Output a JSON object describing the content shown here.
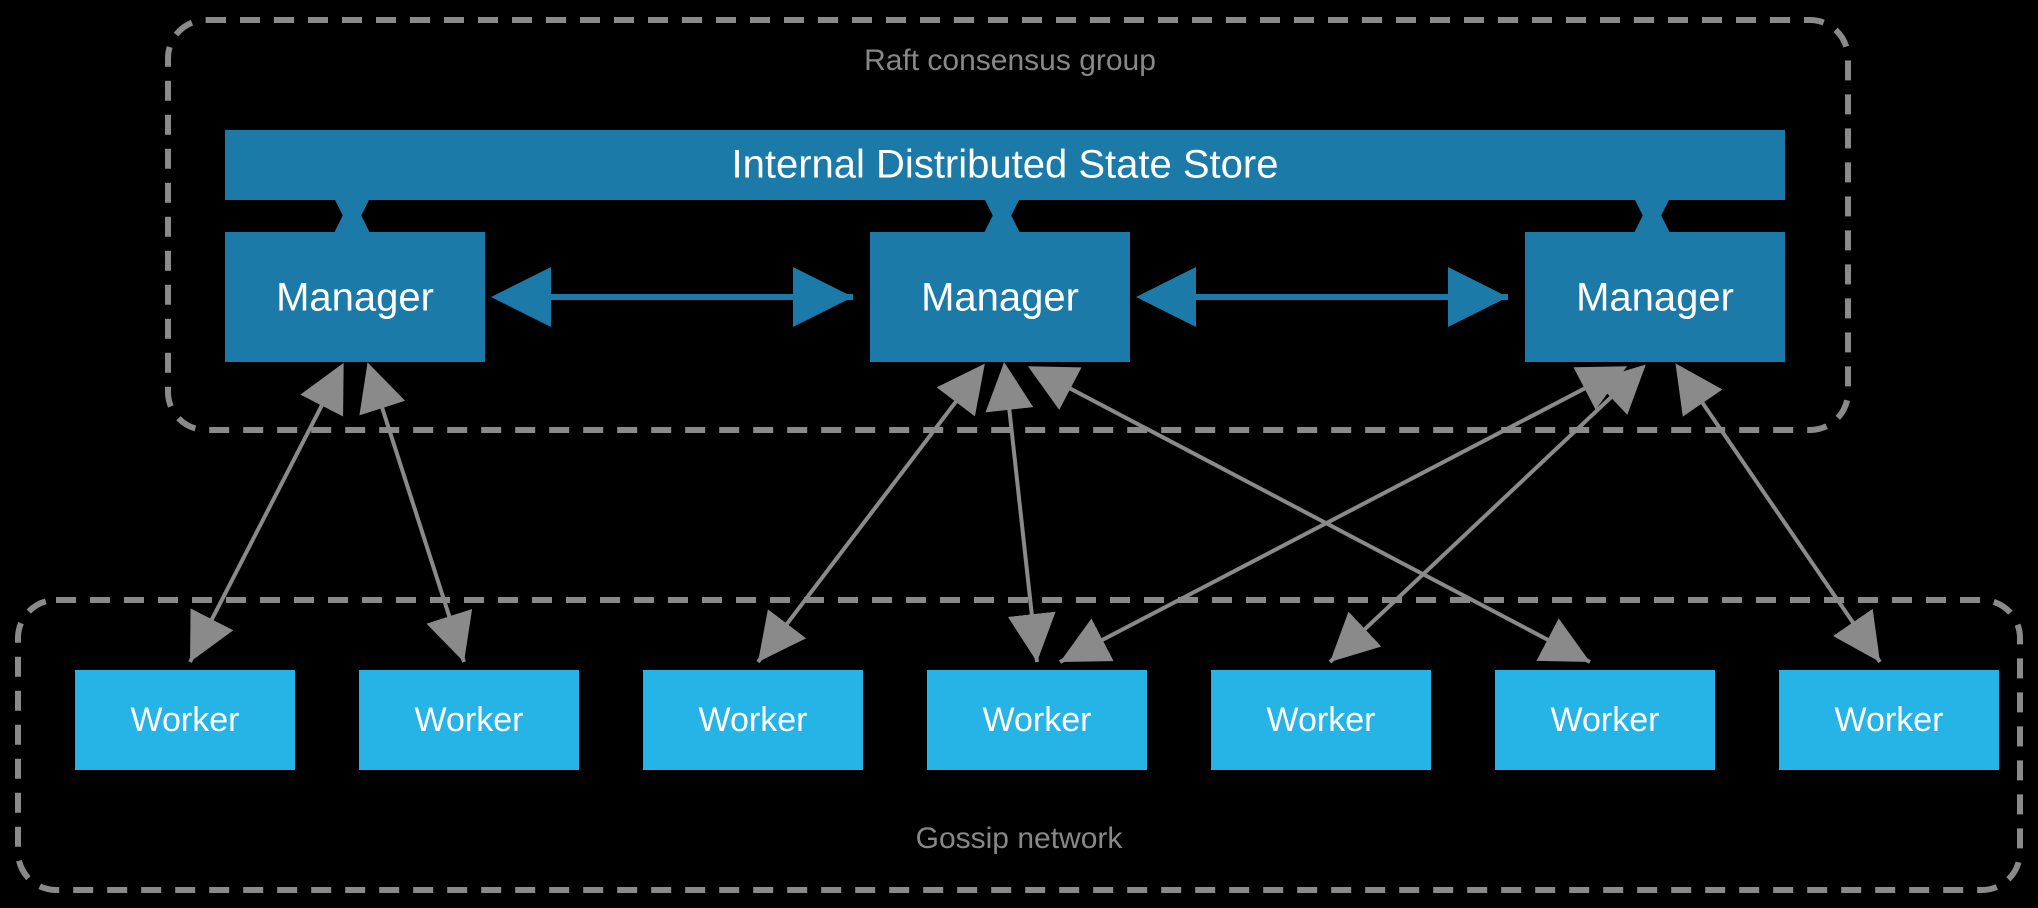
{
  "raft_group": {
    "title": "Raft consensus group",
    "state_store_label": "Internal Distributed State Store",
    "managers": [
      {
        "label": "Manager"
      },
      {
        "label": "Manager"
      },
      {
        "label": "Manager"
      }
    ]
  },
  "gossip_group": {
    "title": "Gossip network",
    "workers": [
      {
        "label": "Worker"
      },
      {
        "label": "Worker"
      },
      {
        "label": "Worker"
      },
      {
        "label": "Worker"
      },
      {
        "label": "Worker"
      },
      {
        "label": "Worker"
      },
      {
        "label": "Worker"
      }
    ]
  },
  "connections": {
    "manager_to_manager": [
      {
        "from": 0,
        "to": 1
      },
      {
        "from": 1,
        "to": 2
      }
    ],
    "manager_to_worker": [
      {
        "manager": 0,
        "worker": 0
      },
      {
        "manager": 0,
        "worker": 1
      },
      {
        "manager": 1,
        "worker": 2
      },
      {
        "manager": 1,
        "worker": 3
      },
      {
        "manager": 1,
        "worker": 5
      },
      {
        "manager": 2,
        "worker": 3
      },
      {
        "manager": 2,
        "worker": 4
      },
      {
        "manager": 2,
        "worker": 6
      }
    ]
  }
}
